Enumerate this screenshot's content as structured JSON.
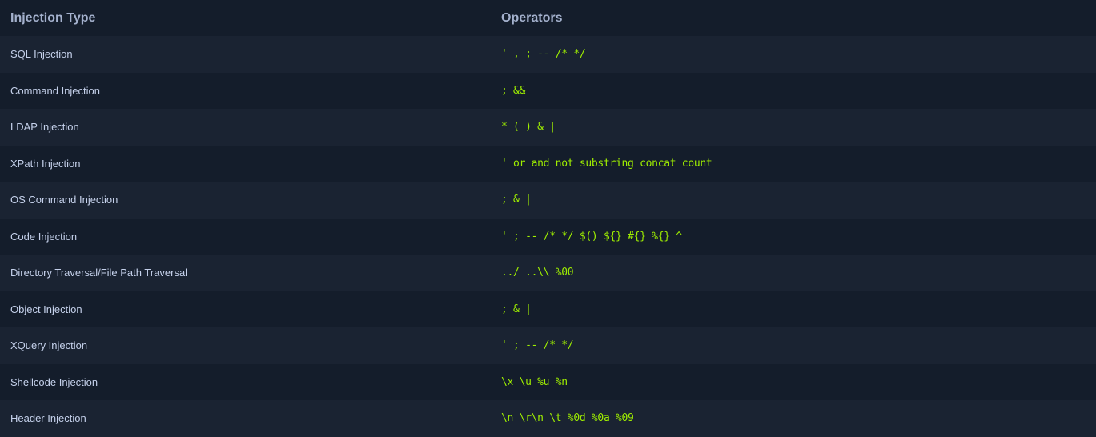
{
  "header": {
    "type_label": "Injection Type",
    "ops_label": "Operators"
  },
  "rows": [
    {
      "type": "SQL Injection",
      "operators": "' , ; -- /* */"
    },
    {
      "type": "Command Injection",
      "operators": "; &&"
    },
    {
      "type": "LDAP Injection",
      "operators": "* ( ) & |"
    },
    {
      "type": "XPath Injection",
      "operators": "' or and not substring concat count"
    },
    {
      "type": "OS Command Injection",
      "operators": "; & |"
    },
    {
      "type": "Code Injection",
      "operators": "' ; -- /* */ $() ${} #{} %{} ^"
    },
    {
      "type": "Directory Traversal/File Path Traversal",
      "operators": "../ ..\\\\ %00"
    },
    {
      "type": "Object Injection",
      "operators": "; & |"
    },
    {
      "type": "XQuery Injection",
      "operators": "' ; -- /* */"
    },
    {
      "type": "Shellcode Injection",
      "operators": "\\x \\u %u %n"
    },
    {
      "type": "Header Injection",
      "operators": "\\n \\r\\n \\t %0d %0a %09"
    }
  ],
  "colors": {
    "background": "#141d2b",
    "row_alt": "#1a2332",
    "header_text": "#a4b1cd",
    "type_text": "#c5d1eb",
    "operator_text": "#9fef00"
  }
}
